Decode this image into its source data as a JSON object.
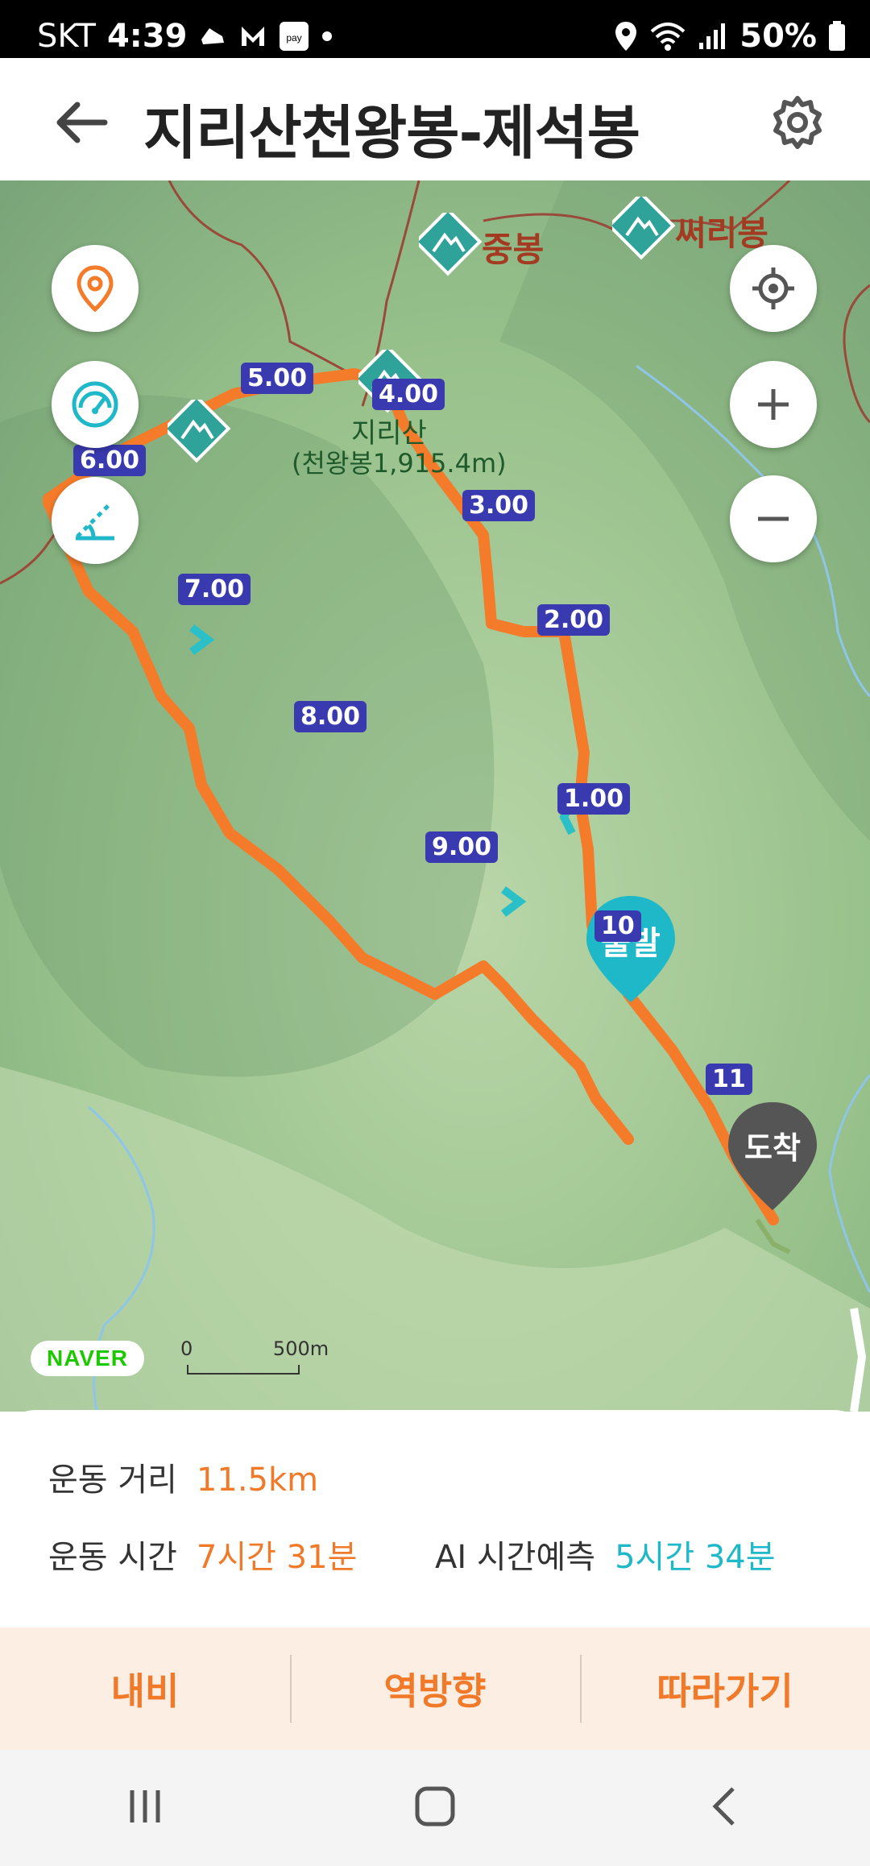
{
  "status_bar": {
    "carrier": "SKT",
    "time": "4:39",
    "battery": "50%"
  },
  "header": {
    "title": "지리산천왕봉-제석봉",
    "back_icon": "arrow-left-icon",
    "settings_icon": "gear-icon"
  },
  "map": {
    "peaks": [
      {
        "name": "중봉"
      },
      {
        "name": "써리봉"
      },
      {
        "name": "지리산",
        "sub": "(천왕봉1,915.4m)"
      }
    ],
    "km_markers": [
      "1.00",
      "2.00",
      "3.00",
      "4.00",
      "5.00",
      "6.00",
      "7.00",
      "8.00",
      "9.00",
      "10",
      "11"
    ],
    "start_label": "출발",
    "end_label": "도착",
    "naver_logo": "NAVER",
    "scale": {
      "zero": "0",
      "label": "500m"
    },
    "route_color": "#f47b2a"
  },
  "stats": {
    "distance_label": "운동 거리",
    "distance_value": "11.5km",
    "time_label": "운동 시간",
    "time_value": "7시간 31분",
    "ai_label": "AI 시간예측",
    "ai_value": "5시간 34분"
  },
  "actions": {
    "navi": "내비",
    "reverse": "역방향",
    "follow": "따라가기"
  }
}
